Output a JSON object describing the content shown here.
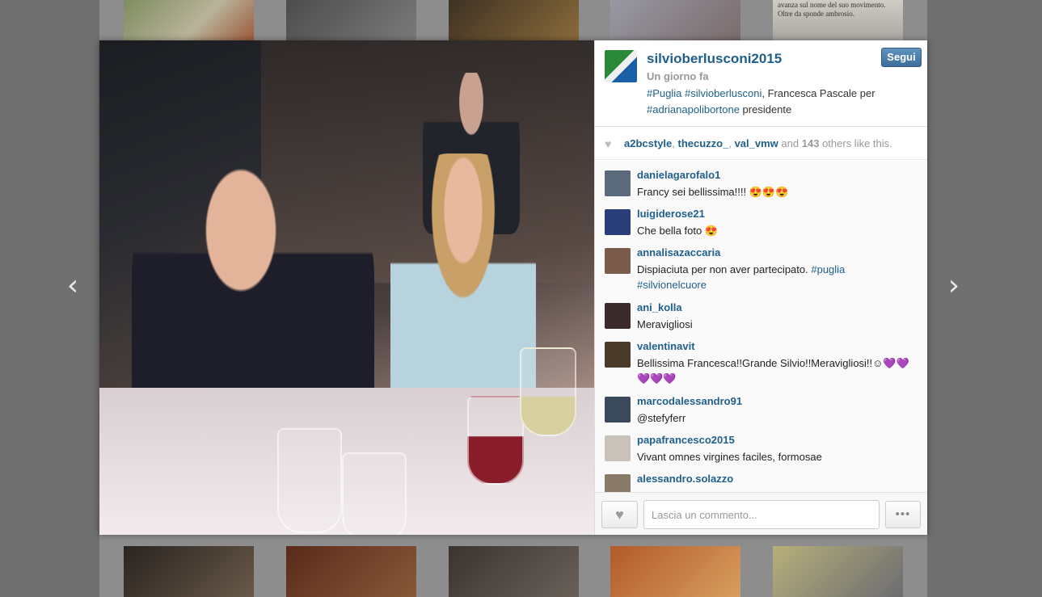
{
  "background": {
    "top_thumb_news_text": "Berlusconi che guida della Regione, avanza sul nome del suo movimento. Oltre da sponde ambrosio."
  },
  "nav": {
    "prev_glyph": "‹",
    "next_glyph": "›"
  },
  "post": {
    "owner": "silvioberlusconi2015",
    "follow_label": "Segui",
    "time": "Un giorno fa",
    "caption": {
      "tag1": "#Puglia",
      "tag2": "#silvioberlusconi",
      "text1": ", Francesca Pascale per",
      "tag3": "#adrianapolibortone",
      "text2": " presidente"
    }
  },
  "likes": {
    "user1": "a2bcstyle",
    "user2": "thecuzzo_",
    "user3": "val_vmw",
    "and": "and",
    "count": "143",
    "suffix": "others like this."
  },
  "comments": [
    {
      "user": "danielagarofalo1",
      "text": "Francy sei bellissima!!!! 😍😍😍",
      "avatar_color": "#5a6a7a"
    },
    {
      "user": "luigiderose21",
      "text": "Che bella foto 😍",
      "avatar_color": "#2a3f7a"
    },
    {
      "user": "annalisazaccaria",
      "text": "Dispiaciuta per non aver partecipato. ",
      "tag": "#puglia",
      "tag2": "#silvionelcuore",
      "avatar_color": "#7a5a4a"
    },
    {
      "user": "ani_kolla",
      "text": "Meravigliosi",
      "avatar_color": "#3a2a2a"
    },
    {
      "user": "valentinavit",
      "text": "Bellissima Francesca!!Grande Silvio!!Meravigliosi!!☺💜💜💜💜💜",
      "avatar_color": "#4a3a2a"
    },
    {
      "user": "marcodalessandro91",
      "text": "@stefyferr",
      "avatar_color": "#3a4a5a"
    },
    {
      "user": "papafrancesco2015",
      "text": "Vivant omnes virgines faciles, formosae",
      "avatar_color": "#c9c2b8"
    },
    {
      "user": "alessandro.solazzo",
      "text": "",
      "avatar_color": "#8a7a6a"
    }
  ],
  "footer": {
    "heart_glyph": "♥",
    "placeholder": "Lascia un commento...",
    "more_glyph": "•••"
  }
}
